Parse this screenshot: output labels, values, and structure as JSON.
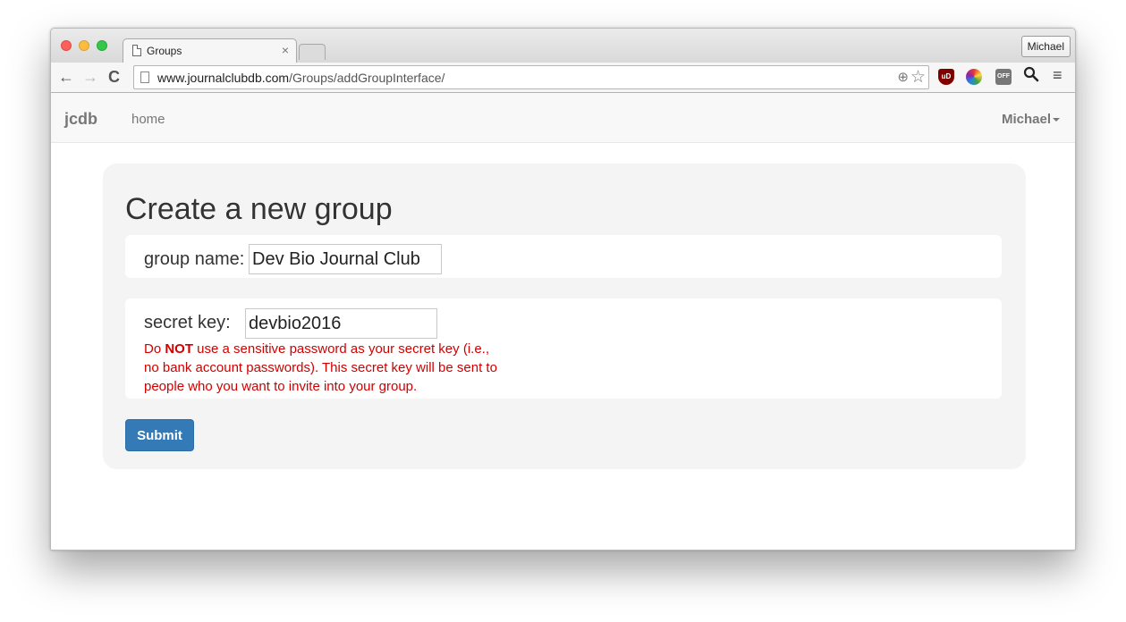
{
  "browser": {
    "tab_title": "Groups",
    "tab_close": "×",
    "profile_name": "Michael",
    "url_host": "www.journalclubdb.com",
    "url_path": "/Groups/addGroupInterface/",
    "icons": {
      "back": "←",
      "forward": "→",
      "reload": "C",
      "zoom": "⊕",
      "star": "☆",
      "ublock": "uD",
      "off": "OFF",
      "search": "🔍",
      "menu": "≡"
    }
  },
  "navbar": {
    "brand": "jcdb",
    "home": "home",
    "user": "Michael"
  },
  "form": {
    "title": "Create a new group",
    "group_name_label": "group name:",
    "group_name_value": "Dev Bio Journal Club",
    "secret_key_label": "secret key:",
    "secret_key_value": "devbio2016",
    "warning_prefix": "Do ",
    "warning_emphasis": "NOT",
    "warning_rest": " use a sensitive password as your secret key (i.e., no bank account passwords). This secret key will be sent to people who you want to invite into your group.",
    "submit_label": "Submit"
  },
  "colors": {
    "submit_bg": "#337ab7",
    "warning_text": "#d10000",
    "jumbotron_bg": "#f4f4f4"
  }
}
